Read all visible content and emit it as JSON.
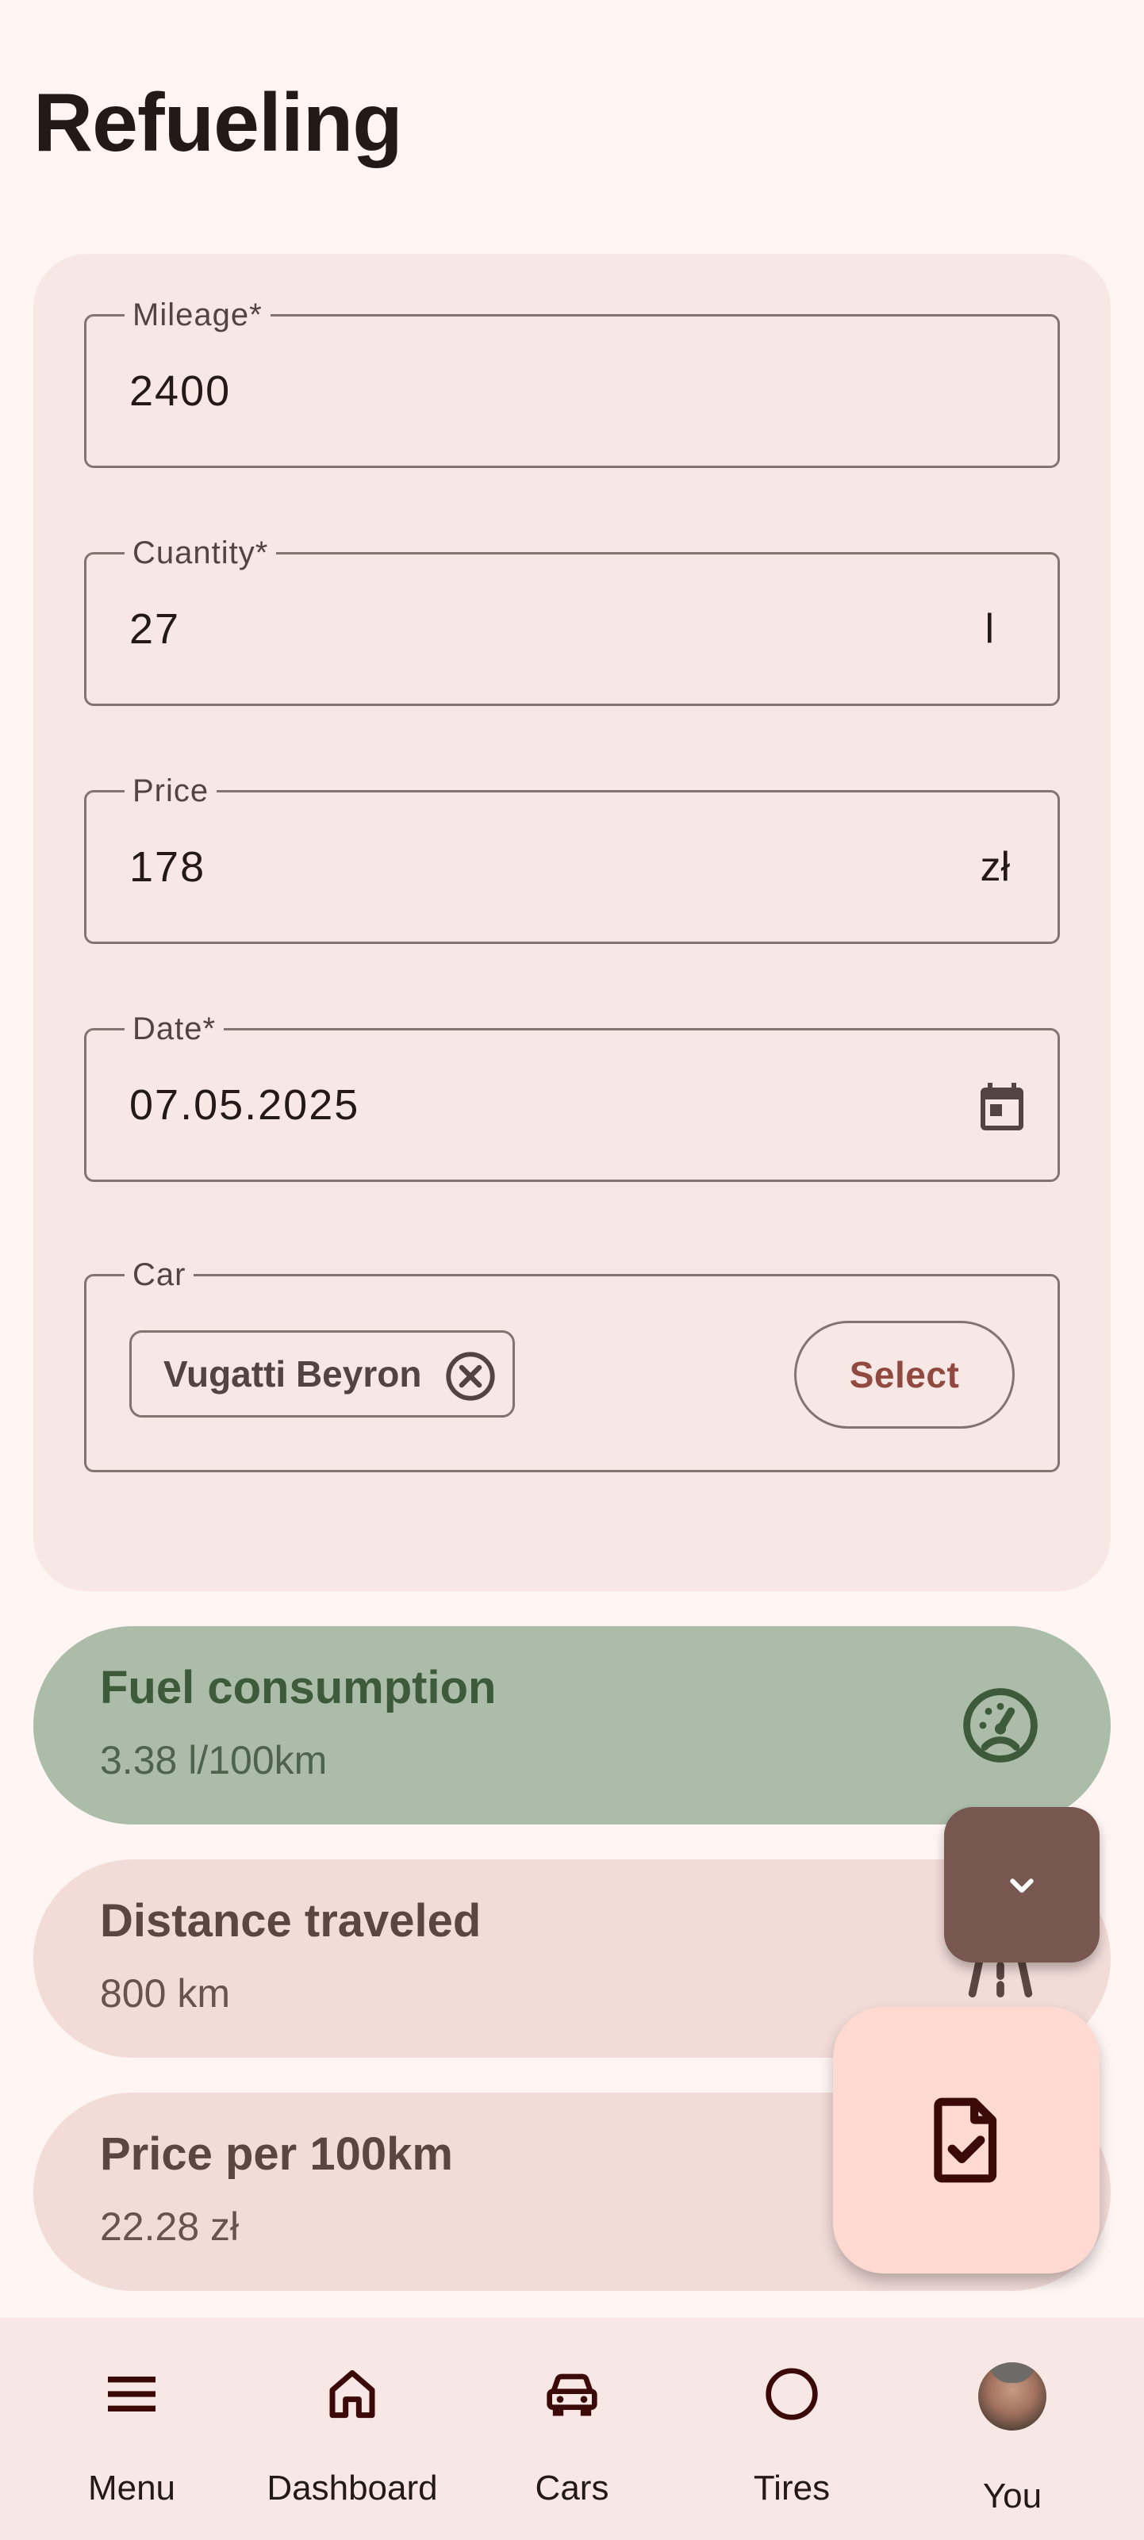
{
  "page": {
    "title": "Refueling"
  },
  "form": {
    "mileage": {
      "label": "Mileage*",
      "value": "2400"
    },
    "quantity": {
      "label": "Cuantity*",
      "value": "27",
      "suffix": "l"
    },
    "price": {
      "label": "Price",
      "value": "178",
      "suffix": "zł"
    },
    "date": {
      "label": "Date*",
      "value": "07.05.2025",
      "icon": "calendar-icon"
    },
    "car": {
      "label": "Car",
      "chip": "Vugatti Beyron",
      "select_label": "Select"
    }
  },
  "stats": {
    "fuel": {
      "title": "Fuel consumption",
      "value": "3.38  l/100km",
      "icon": "gauge-icon"
    },
    "distance": {
      "title": "Distance traveled",
      "value": "800 km",
      "icon": "road-icon"
    },
    "price100": {
      "title": "Price per 100km",
      "value": "22.28 zł"
    }
  },
  "fabs": {
    "collapse_icon": "chevron-down-icon",
    "save_icon": "document-check-icon"
  },
  "nav": {
    "items": [
      {
        "label": "Menu",
        "icon": "menu-icon"
      },
      {
        "label": "Dashboard",
        "icon": "home-icon"
      },
      {
        "label": "Cars",
        "icon": "car-icon"
      },
      {
        "label": "Tires",
        "icon": "circle-icon"
      },
      {
        "label": "You",
        "icon": "avatar"
      }
    ]
  },
  "colors": {
    "background": "#fff6f4",
    "card": "#f8e8e5",
    "fuel_card": "#abbca9",
    "stat_card": "#f3dcd8",
    "fab_small": "#77574f",
    "fab_large": "#ffdad3",
    "accent_text": "#904a3f"
  }
}
